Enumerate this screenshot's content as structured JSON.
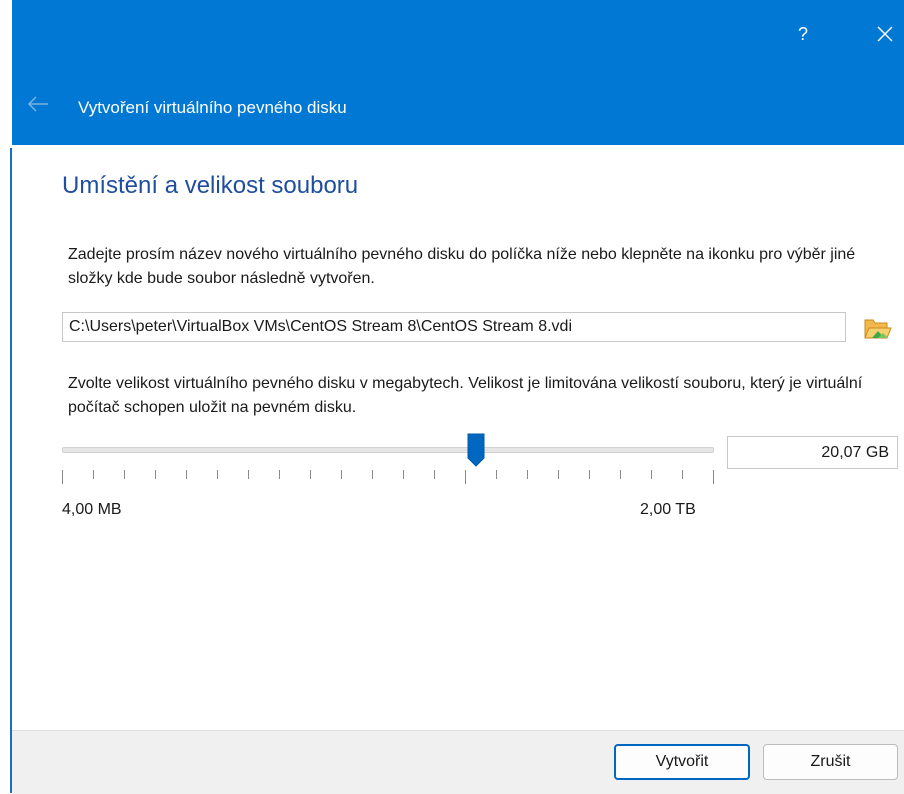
{
  "window": {
    "title": "Vytvoření virtuálního pevného disku",
    "help_label": "?",
    "accent_color": "#0078d4"
  },
  "section": {
    "title": "Umístění a velikost souboru",
    "location_description": "Zadejte prosím název nového virtuálního pevného disku do políčka níže nebo klepněte na ikonku pro výběr jiné složky kde bude soubor následně vytvořen.",
    "size_description": "Zvolte velikost virtuálního pevného disku v megabytech. Velikost je limitována velikostí souboru, který je virtuální počítač schopen uložit na pevném disku."
  },
  "file_path": {
    "value": "C:\\Users\\peter\\VirtualBox VMs\\CentOS Stream 8\\CentOS Stream 8.vdi"
  },
  "size_slider": {
    "min_label": "4,00 MB",
    "max_label": "2,00 TB",
    "value_fraction": 0.64,
    "size_value": "20,07 GB"
  },
  "buttons": {
    "create_label": "Vytvořit",
    "cancel_label": "Zrušit"
  },
  "icons": {
    "back": "arrow-left-icon",
    "close": "close-icon",
    "folder": "folder-open-icon"
  }
}
